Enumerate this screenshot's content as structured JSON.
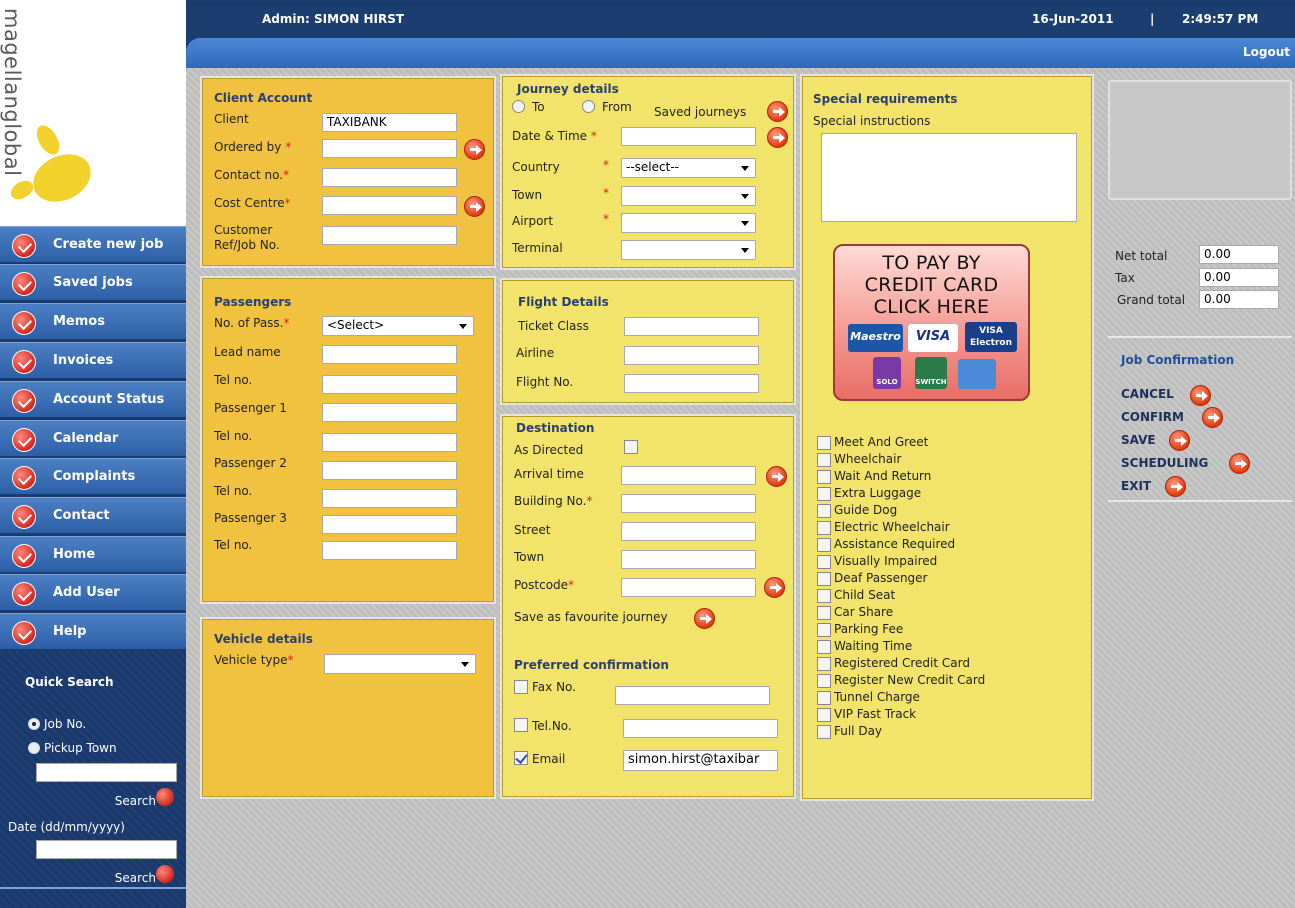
{
  "header": {
    "admin": "Admin:  SIMON HIRST",
    "date": "16-Jun-2011",
    "separator": "|",
    "time": "2:49:57 PM",
    "logout": "Logout"
  },
  "logo": {
    "text": "magellanglobal"
  },
  "sidebar": {
    "items": [
      {
        "label": "Create new job",
        "icon": "key-icon"
      },
      {
        "label": "Saved jobs",
        "icon": "check-icon"
      },
      {
        "label": "Memos",
        "icon": "envelope-icon"
      },
      {
        "label": "Invoices",
        "icon": "invoice-icon"
      },
      {
        "label": "Account Status",
        "icon": "document-icon"
      },
      {
        "label": "Calendar",
        "icon": "calendar-icon"
      },
      {
        "label": "Complaints",
        "icon": "complaint-icon"
      },
      {
        "label": "Contact",
        "icon": "phone-icon"
      },
      {
        "label": "Home",
        "icon": "home-icon"
      },
      {
        "label": "Add User",
        "icon": "check-icon"
      },
      {
        "label": "Help",
        "icon": "help-icon"
      }
    ]
  },
  "quick_search": {
    "title": "Quick Search",
    "option_job": "Job No.",
    "option_town": "Pickup Town",
    "search1": "Search",
    "date_label": "Date (dd/mm/yyyy)",
    "search2": "Search"
  },
  "client_account": {
    "title": "Client Account",
    "client_label": "Client",
    "client_value": "TAXIBANK",
    "ordered_by": "Ordered by",
    "contact_no": "Contact no.",
    "cost_centre": "Cost Centre",
    "customer_ref_1": "Customer",
    "customer_ref_2": "Ref/Job No.",
    "required_mark": "*"
  },
  "passengers": {
    "title": "Passengers",
    "no_of_pass": "No. of Pass.",
    "no_of_pass_value": "<Select>",
    "lead_name": "Lead name",
    "tel": "Tel no.",
    "passenger1": "Passenger 1",
    "passenger2": "Passenger 2",
    "passenger3": "Passenger 3"
  },
  "vehicle": {
    "title": "Vehicle details",
    "vehicle_type": "Vehicle type"
  },
  "journey": {
    "title": "Journey details",
    "to": "To",
    "from": "From",
    "saved_journeys": "Saved journeys",
    "date_time": "Date & Time",
    "country": "Country",
    "country_value": "--select--",
    "town": "Town",
    "airport": "Airport",
    "terminal": "Terminal"
  },
  "flight": {
    "title": "Flight Details",
    "ticket_class": "Ticket Class",
    "airline": "Airline",
    "flight_no": "Flight No."
  },
  "destination": {
    "title": "Destination",
    "as_directed": "As Directed",
    "arrival_time": "Arrival time",
    "building_no": "Building No.",
    "street": "Street",
    "town": "Town",
    "postcode": "Postcode",
    "save_favourite": "Save as favourite journey",
    "preferred_confirmation": "Preferred confirmation",
    "fax_no": "Fax No.",
    "tel_no": "Tel.No.",
    "email": "Email",
    "email_value": "simon.hirst@taxibar"
  },
  "special": {
    "title": "Special requirements",
    "instructions": "Special instructions",
    "options": [
      "Meet And Greet",
      "Wheelchair",
      "Wait And Return",
      "Extra Luggage",
      "Guide Dog",
      "Electric Wheelchair",
      "Assistance Required",
      "Visually Impaired",
      "Deaf Passenger",
      "Child Seat",
      "Car Share",
      "Parking Fee",
      "Waiting Time",
      "Registered Credit Card",
      "Register New Credit Card",
      "Tunnel Charge",
      "VIP Fast Track",
      "Full Day"
    ]
  },
  "credit_card": {
    "line1": "TO PAY BY",
    "line2": "CREDIT CARD",
    "line3": "CLICK HERE",
    "maestro": "Maestro",
    "visa": "VISA",
    "visa_electron_1": "VISA",
    "visa_electron_2": "Electron",
    "solo": "SOLO",
    "switch": "SWITCH"
  },
  "totals": {
    "net_label": "Net total",
    "net_value": "0.00",
    "tax_label": "Tax",
    "tax_value": "0.00",
    "grand_label": "Grand total",
    "grand_value": "0.00"
  },
  "job_confirmation": {
    "title": "Job Confirmation",
    "cancel": "CANCEL",
    "confirm": "CONFIRM",
    "save": "SAVE",
    "scheduling": "SCHEDULING",
    "exit": "EXIT"
  },
  "colors": {
    "header_bg": "#1a3b6e",
    "panel_orange": "#f0c240",
    "panel_yellow": "#f2e46a",
    "title_blue": "#2a3f72",
    "required_red": "#e02020"
  }
}
